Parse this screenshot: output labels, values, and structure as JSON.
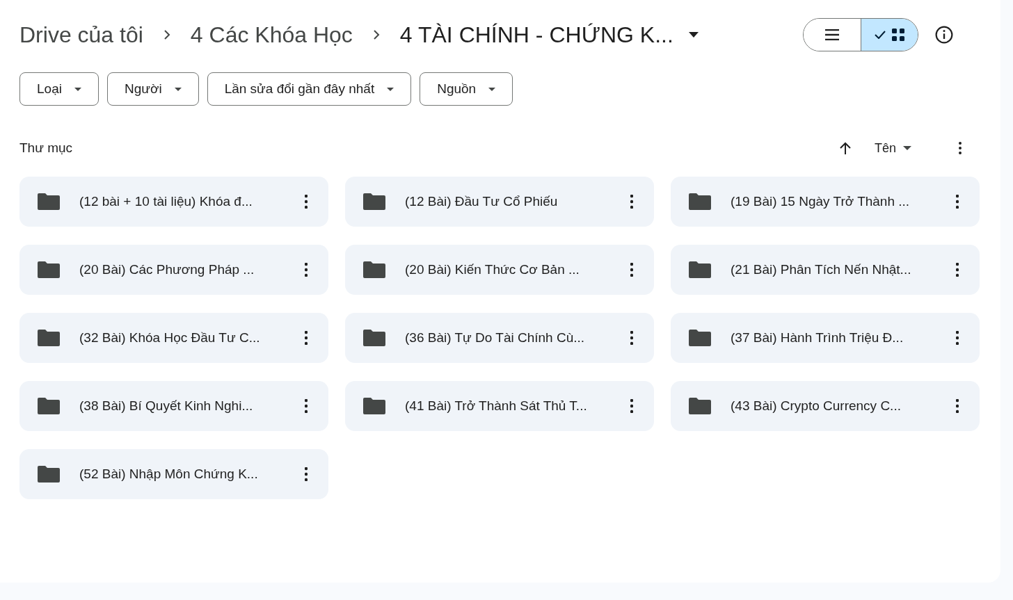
{
  "breadcrumb": [
    {
      "label": "Drive của tôi"
    },
    {
      "label": "4 Các Khóa Học"
    },
    {
      "label": "4 TÀI CHÍNH - CHỨNG K..."
    }
  ],
  "views": [
    {
      "kind": "list",
      "selected": false
    },
    {
      "kind": "grid",
      "selected": true
    }
  ],
  "filters": [
    {
      "label": "Loại"
    },
    {
      "label": "Người"
    },
    {
      "label": "Lần sửa đổi gần đây nhất"
    },
    {
      "label": "Nguồn"
    }
  ],
  "section_title": "Thư mục",
  "sort": {
    "label": "Tên"
  },
  "folders": [
    {
      "name": "(12 bài + 10 tài liệu) Khóa đ..."
    },
    {
      "name": "(12 Bài) Đầu Tư Cổ Phiếu"
    },
    {
      "name": "(19 Bài) 15 Ngày Trở Thành ..."
    },
    {
      "name": "(20 Bài) Các Phương Pháp ..."
    },
    {
      "name": "(20 Bài) Kiến Thức Cơ Bản ..."
    },
    {
      "name": "(21 Bài) Phân Tích Nến Nhật..."
    },
    {
      "name": "(32 Bài) Khóa Học Đầu Tư C..."
    },
    {
      "name": "(36 Bài) Tự Do Tài Chính Cù..."
    },
    {
      "name": "(37 Bài) Hành Trình Triệu Đ..."
    },
    {
      "name": "(38 Bài) Bí Quyết Kinh Nghi..."
    },
    {
      "name": "(41 Bài) Trở Thành Sát Thủ T..."
    },
    {
      "name": "(43 Bài) Crypto Currency C..."
    },
    {
      "name": "(52 Bài) Nhập Môn Chứng K..."
    }
  ]
}
